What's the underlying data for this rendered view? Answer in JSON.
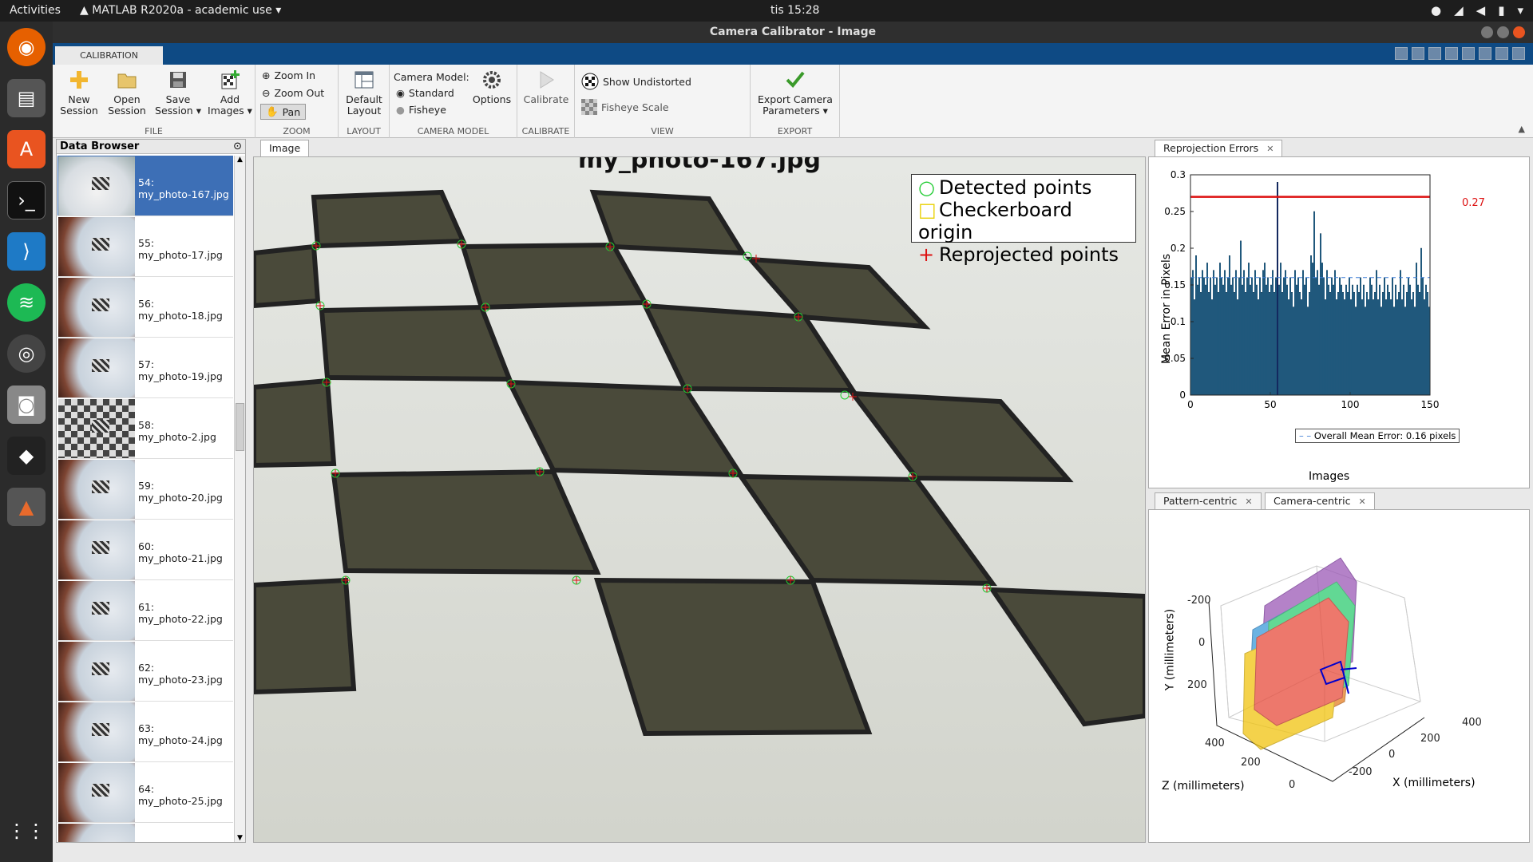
{
  "topbar": {
    "activities": "Activities",
    "app": "MATLAB R2020a - academic use",
    "clock": "tis 15:28"
  },
  "window": {
    "title": "Camera Calibrator - Image"
  },
  "ribbon": {
    "tab": "CALIBRATION",
    "file": {
      "new": "New Session",
      "open": "Open Session",
      "save": "Save Session",
      "add": "Add Images",
      "label": "FILE"
    },
    "zoom": {
      "in": "Zoom In",
      "out": "Zoom Out",
      "pan": "Pan",
      "label": "ZOOM"
    },
    "layout": {
      "default": "Default Layout",
      "label": "LAYOUT"
    },
    "camera": {
      "model": "Camera Model:",
      "standard": "Standard",
      "fisheye": "Fisheye",
      "options": "Options",
      "label": "CAMERA MODEL"
    },
    "calibrate": {
      "btn": "Calibrate",
      "label": "CALIBRATE"
    },
    "view": {
      "undist": "Show Undistorted",
      "fisheye_scale": "Fisheye Scale",
      "label": "VIEW"
    },
    "export": {
      "btn": "Export Camera Parameters",
      "label": "EXPORT"
    }
  },
  "browser": {
    "title": "Data Browser",
    "items": [
      {
        "n": "54:",
        "f": "my_photo-167.jpg"
      },
      {
        "n": "55:",
        "f": "my_photo-17.jpg"
      },
      {
        "n": "56:",
        "f": "my_photo-18.jpg"
      },
      {
        "n": "57:",
        "f": "my_photo-19.jpg"
      },
      {
        "n": "58:",
        "f": "my_photo-2.jpg"
      },
      {
        "n": "59:",
        "f": "my_photo-20.jpg"
      },
      {
        "n": "60:",
        "f": "my_photo-21.jpg"
      },
      {
        "n": "61:",
        "f": "my_photo-22.jpg"
      },
      {
        "n": "62:",
        "f": "my_photo-23.jpg"
      },
      {
        "n": "63:",
        "f": "my_photo-24.jpg"
      },
      {
        "n": "64:",
        "f": "my_photo-25.jpg"
      }
    ]
  },
  "image": {
    "tab": "Image",
    "title": "my_photo-167.jpg",
    "legend": [
      "Detected points",
      "Checkerboard origin",
      "Reprojected points"
    ]
  },
  "reproj": {
    "tab": "Reprojection Errors",
    "mean_label": "0.27",
    "legend": "Overall Mean Error: 0.16 pixels"
  },
  "extr": {
    "tabs": [
      "Pattern-centric",
      "Camera-centric"
    ],
    "ylabel": "Y (millimeters)",
    "zlabel": "Z (millimeters)",
    "xlabel": "X (millimeters)",
    "yticks": [
      "-200",
      "0",
      "200"
    ],
    "zticks": [
      "400",
      "200",
      "0"
    ],
    "xticks": [
      "-200",
      "0",
      "200",
      "400"
    ]
  },
  "chart_data": {
    "type": "bar",
    "xlabel": "Images",
    "ylabel": "Mean Error in Pixels",
    "xlim": [
      0,
      150
    ],
    "ylim": [
      0,
      0.3
    ],
    "xticks": [
      0,
      50,
      100,
      150
    ],
    "yticks": [
      0,
      0.05,
      0.1,
      0.15,
      0.2,
      0.25,
      0.3
    ],
    "overall_mean": 0.16,
    "highlight_value": 0.27,
    "highlight_index": 54,
    "values": [
      0.16,
      0.17,
      0.13,
      0.19,
      0.15,
      0.16,
      0.14,
      0.17,
      0.16,
      0.15,
      0.18,
      0.14,
      0.16,
      0.13,
      0.17,
      0.15,
      0.16,
      0.14,
      0.18,
      0.16,
      0.15,
      0.17,
      0.14,
      0.16,
      0.19,
      0.15,
      0.16,
      0.14,
      0.17,
      0.13,
      0.16,
      0.21,
      0.15,
      0.17,
      0.14,
      0.16,
      0.18,
      0.15,
      0.16,
      0.14,
      0.17,
      0.15,
      0.13,
      0.16,
      0.14,
      0.17,
      0.18,
      0.15,
      0.16,
      0.14,
      0.15,
      0.17,
      0.14,
      0.16,
      0.29,
      0.15,
      0.18,
      0.14,
      0.16,
      0.17,
      0.15,
      0.13,
      0.16,
      0.14,
      0.12,
      0.17,
      0.15,
      0.16,
      0.14,
      0.13,
      0.17,
      0.15,
      0.16,
      0.12,
      0.14,
      0.19,
      0.18,
      0.25,
      0.16,
      0.17,
      0.15,
      0.22,
      0.18,
      0.16,
      0.13,
      0.17,
      0.15,
      0.14,
      0.16,
      0.15,
      0.17,
      0.13,
      0.14,
      0.16,
      0.15,
      0.14,
      0.13,
      0.15,
      0.14,
      0.16,
      0.13,
      0.15,
      0.14,
      0.12,
      0.15,
      0.14,
      0.16,
      0.13,
      0.15,
      0.12,
      0.14,
      0.13,
      0.16,
      0.15,
      0.13,
      0.14,
      0.17,
      0.13,
      0.15,
      0.12,
      0.14,
      0.16,
      0.13,
      0.15,
      0.14,
      0.13,
      0.16,
      0.12,
      0.15,
      0.13,
      0.14,
      0.17,
      0.13,
      0.15,
      0.12,
      0.14,
      0.16,
      0.15,
      0.13,
      0.14,
      0.12,
      0.18,
      0.15,
      0.14,
      0.2,
      0.16,
      0.13,
      0.15,
      0.14,
      0.12
    ]
  }
}
